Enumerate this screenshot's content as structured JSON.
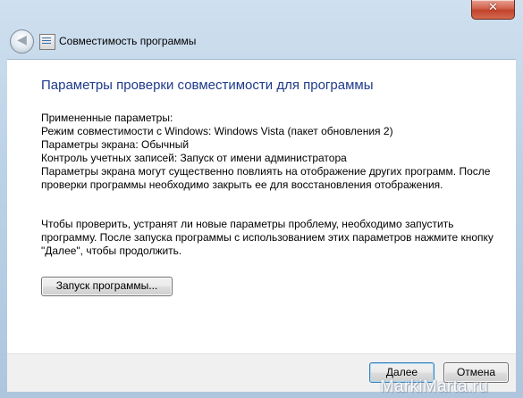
{
  "window": {
    "close_glyph": "✕"
  },
  "header": {
    "back_glyph": "◀",
    "title": "Совместимость программы"
  },
  "main": {
    "heading": "Параметры проверки совместимости для программы",
    "settings_intro": "Примененные параметры:",
    "compat_mode": "Режим совместимости с Windows: Windows Vista (пакет обновления 2)",
    "screen_params": "Параметры экрана:  Обычный",
    "uac": "Контроль учетных записей:  Запуск от имени администратора",
    "warning": "Параметры экрана могут существенно повлиять на отображение других программ. После проверки программы необходимо закрыть ее для восстановления отображения.",
    "instructions": "Чтобы проверить, устранят ли новые параметры проблему, необходимо запустить программу. После запуска программы с использованием этих параметров нажмите кнопку \"Далее\", чтобы продолжить.",
    "launch_button": "Запуск программы..."
  },
  "footer": {
    "next_button": "Далее",
    "cancel_button": "Отмена"
  },
  "watermark": "MarkiMarta.ru",
  "colors": {
    "heading": "#1e3a8a",
    "frame": "#bcd2e6",
    "close_button": "#c2432c"
  }
}
